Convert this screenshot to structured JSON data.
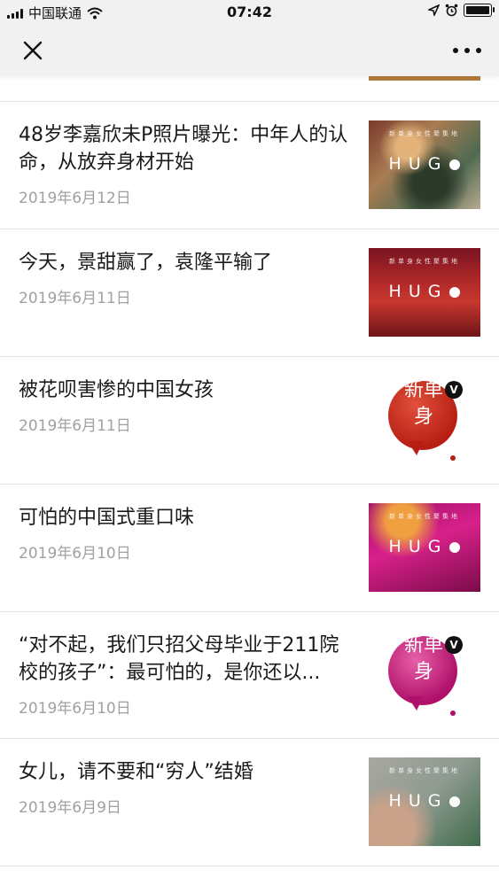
{
  "status_bar": {
    "carrier": "中国联通",
    "time": "07:42"
  },
  "articles": [
    {
      "title": "48岁李嘉欣未P照片曝光：中年人的认命，从放弃身材开始",
      "date": "2019年6月12日",
      "thumb_text": "HUGO",
      "thumb_small": "新单身女性聚集地",
      "thumb_style": "hugo-green"
    },
    {
      "title": "今天，景甜赢了，袁隆平输了",
      "date": "2019年6月11日",
      "thumb_text": "HUGO",
      "thumb_small": "新单身女性聚集地",
      "thumb_style": "hugo-red"
    },
    {
      "title": "被花呗害惨的中国女孩",
      "date": "2019年6月11日",
      "thumb_text": "新单身",
      "thumb_style": "logo-red"
    },
    {
      "title": "可怕的中国式重口味",
      "date": "2019年6月10日",
      "thumb_text": "HUGO",
      "thumb_small": "新单身女性聚集地",
      "thumb_style": "hugo-pink"
    },
    {
      "title": "“对不起，我们只招父母毕业于211院校的孩子”：最可怕的，是你还以...",
      "date": "2019年6月10日",
      "thumb_text": "新单身",
      "thumb_style": "logo-pink"
    },
    {
      "title": "女儿，请不要和“穷人”结婚",
      "date": "2019年6月9日",
      "thumb_text": "HUGO",
      "thumb_small": "新单身女性聚集地",
      "thumb_style": "hugo-gray"
    }
  ],
  "colors": {
    "logo_red": "#c62a1c",
    "logo_pink": "#d0207a"
  },
  "icons": [
    "signal-icon",
    "wifi-icon",
    "location-icon",
    "alarm-icon",
    "battery-icon",
    "close-icon",
    "more-icon"
  ]
}
